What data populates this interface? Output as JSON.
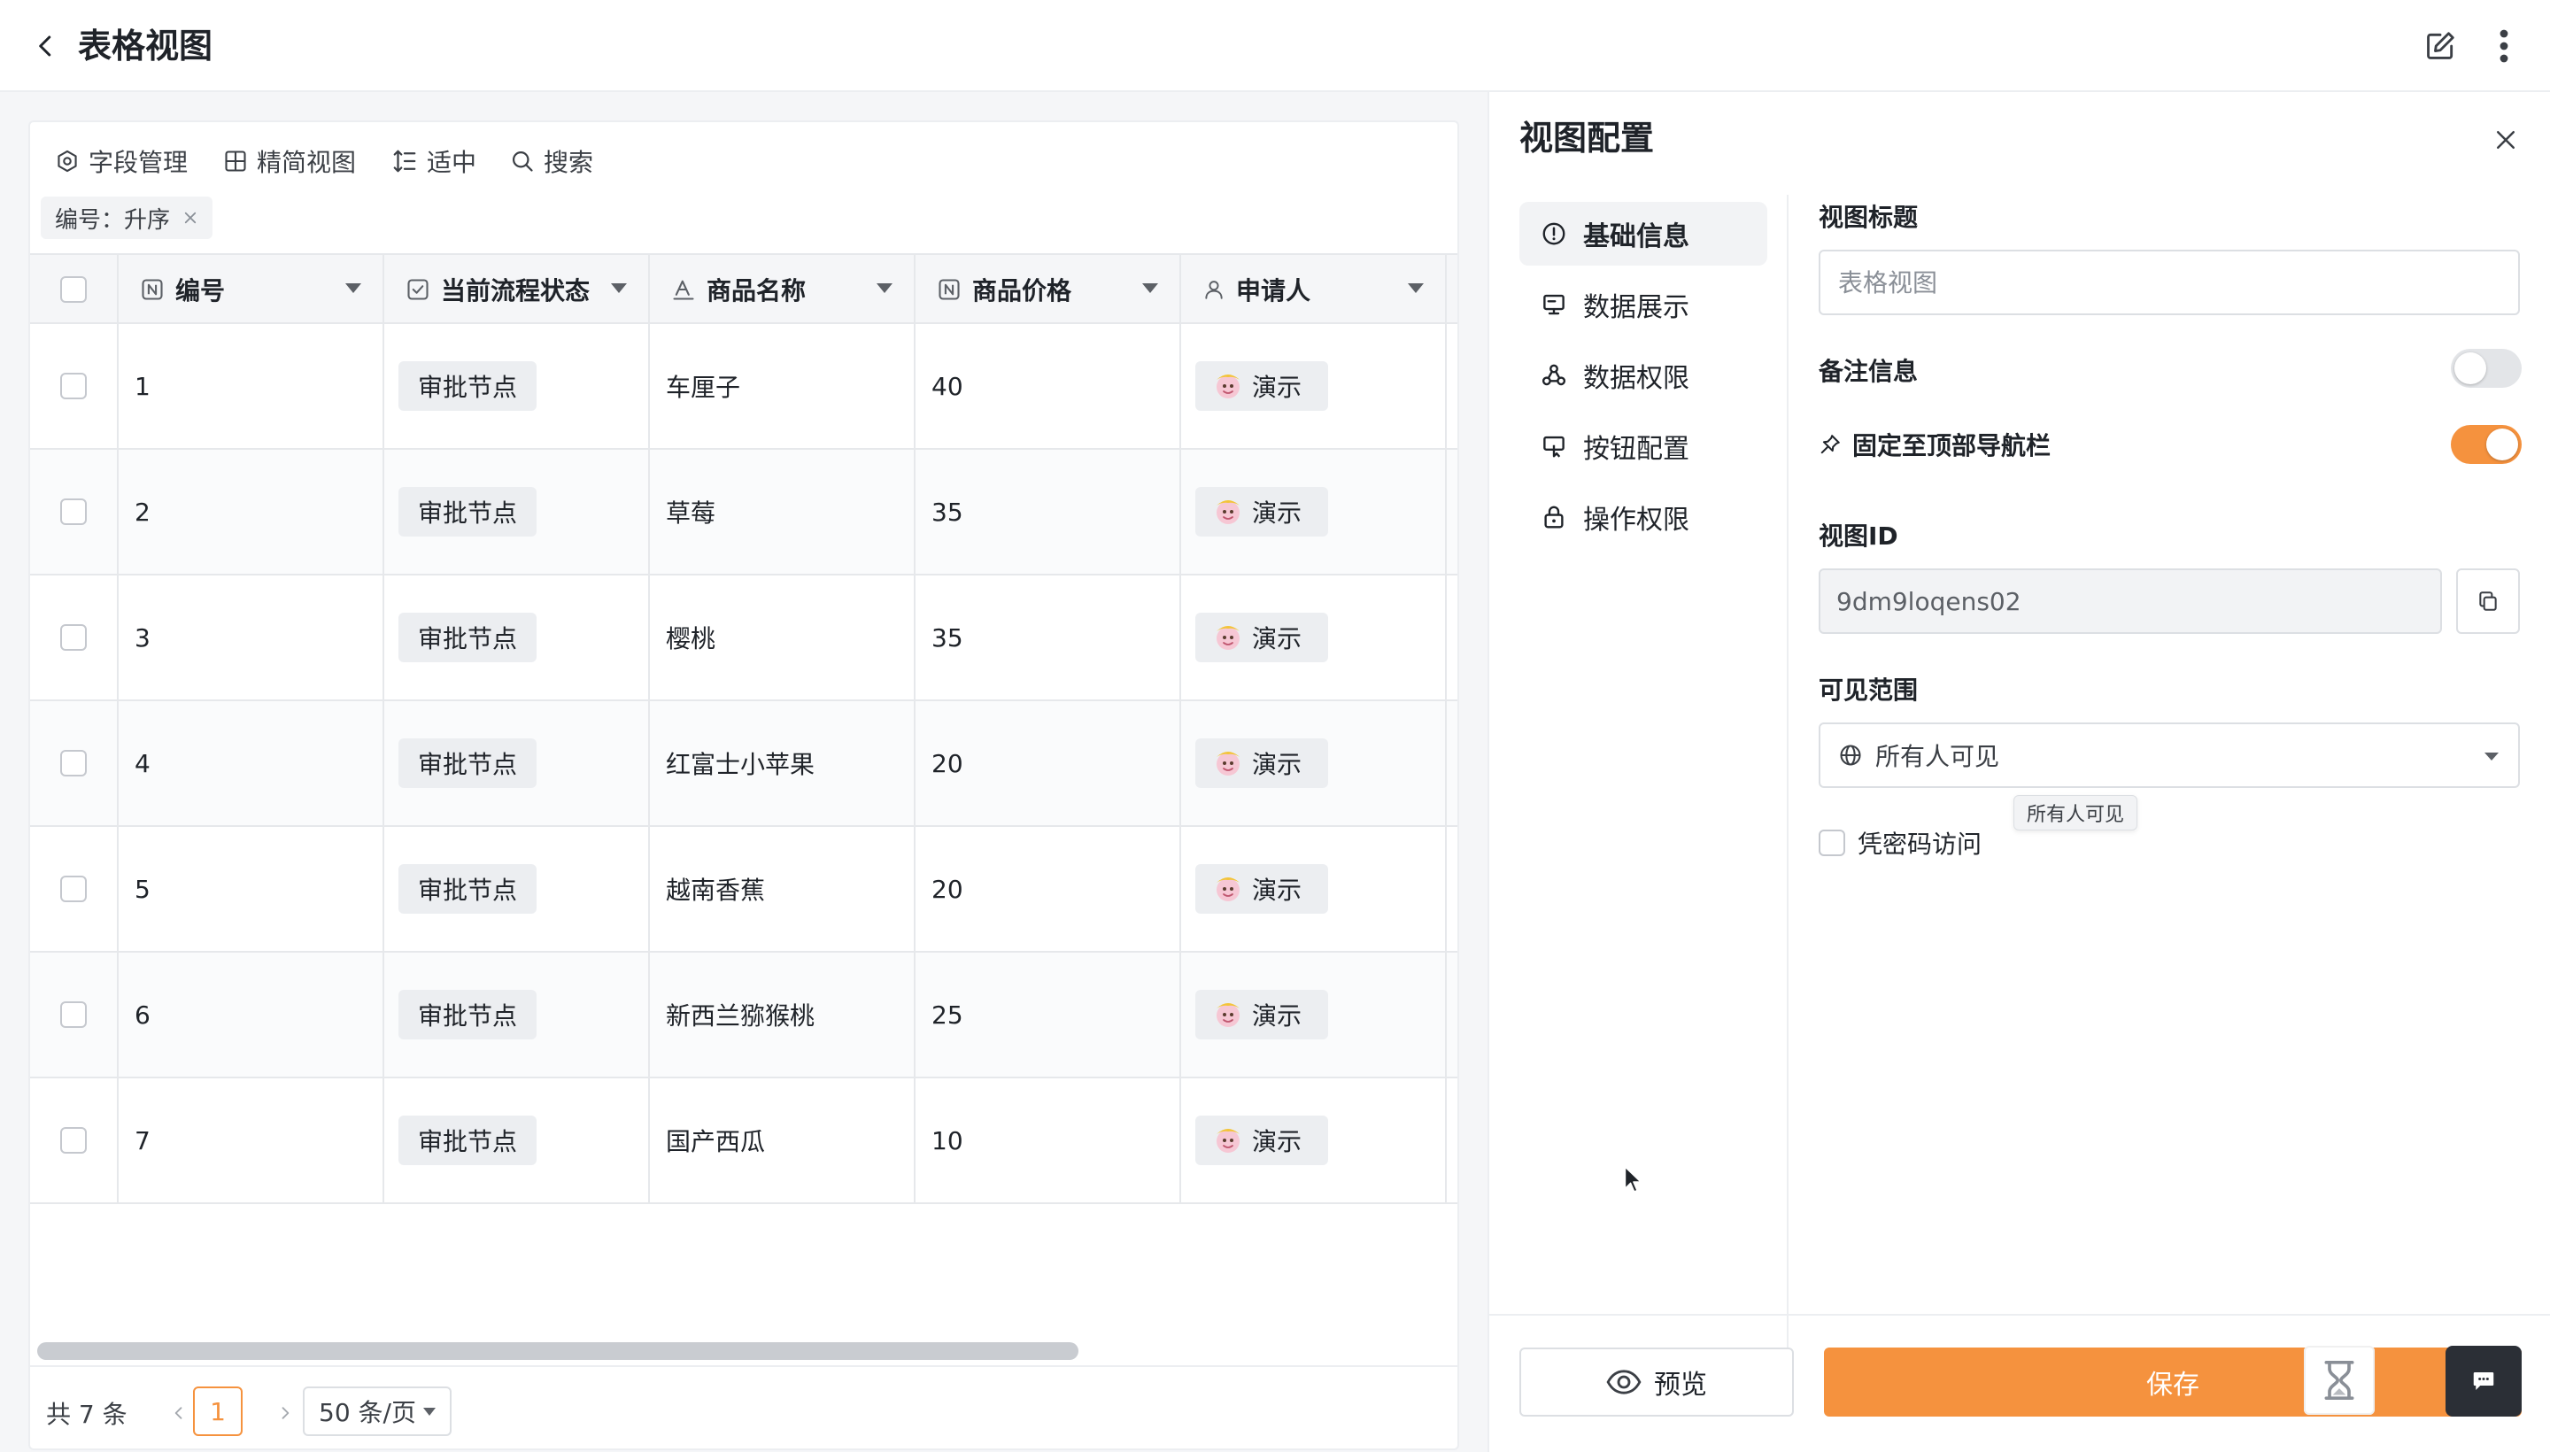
{
  "header": {
    "title": "表格视图"
  },
  "toolbar": {
    "field_manage": "字段管理",
    "compact_view": "精简视图",
    "row_height": "适中",
    "search": "搜索"
  },
  "sort_tag": {
    "label": "编号：升序"
  },
  "table": {
    "columns": [
      {
        "label": "编号",
        "icon": "number-field-icon"
      },
      {
        "label": "当前流程状态",
        "icon": "checkbox-field-icon"
      },
      {
        "label": "商品名称",
        "icon": "text-field-icon"
      },
      {
        "label": "商品价格",
        "icon": "number-field-icon"
      },
      {
        "label": "申请人",
        "icon": "user-field-icon"
      }
    ],
    "rows": [
      {
        "id": "1",
        "status": "审批节点",
        "name": "车厘子",
        "price": "40",
        "applicant": "演示"
      },
      {
        "id": "2",
        "status": "审批节点",
        "name": "草莓",
        "price": "35",
        "applicant": "演示"
      },
      {
        "id": "3",
        "status": "审批节点",
        "name": "樱桃",
        "price": "35",
        "applicant": "演示"
      },
      {
        "id": "4",
        "status": "审批节点",
        "name": "红富士小苹果",
        "price": "20",
        "applicant": "演示"
      },
      {
        "id": "5",
        "status": "审批节点",
        "name": "越南香蕉",
        "price": "20",
        "applicant": "演示"
      },
      {
        "id": "6",
        "status": "审批节点",
        "name": "新西兰猕猴桃",
        "price": "25",
        "applicant": "演示"
      },
      {
        "id": "7",
        "status": "审批节点",
        "name": "国产西瓜",
        "price": "10",
        "applicant": "演示"
      }
    ]
  },
  "pagination": {
    "total": "共 7 条",
    "current_page": "1",
    "page_size": "50 条/页"
  },
  "panel": {
    "title": "视图配置",
    "menu": [
      {
        "label": "基础信息",
        "icon": "info-icon",
        "active": true
      },
      {
        "label": "数据展示",
        "icon": "monitor-icon",
        "active": false
      },
      {
        "label": "数据权限",
        "icon": "data-permission-icon",
        "active": false
      },
      {
        "label": "按钮配置",
        "icon": "button-config-icon",
        "active": false
      },
      {
        "label": "操作权限",
        "icon": "lock-icon",
        "active": false
      }
    ],
    "view_title_label": "视图标题",
    "view_title_placeholder": "表格视图",
    "remark_label": "备注信息",
    "remark_enabled": false,
    "pin_label": "固定至顶部导航栏",
    "pin_enabled": true,
    "view_id_label": "视图ID",
    "view_id_value": "9dm9loqens02",
    "scope_label": "可见范围",
    "scope_value": "所有人可见",
    "scope_tooltip": "所有人可见",
    "password_label": "凭密码访问",
    "preview_label": "预览",
    "save_label": "保存"
  },
  "colors": {
    "accent": "#f5923e",
    "switch_off": "#e3e5e8",
    "dark_button": "#2b2f36"
  }
}
